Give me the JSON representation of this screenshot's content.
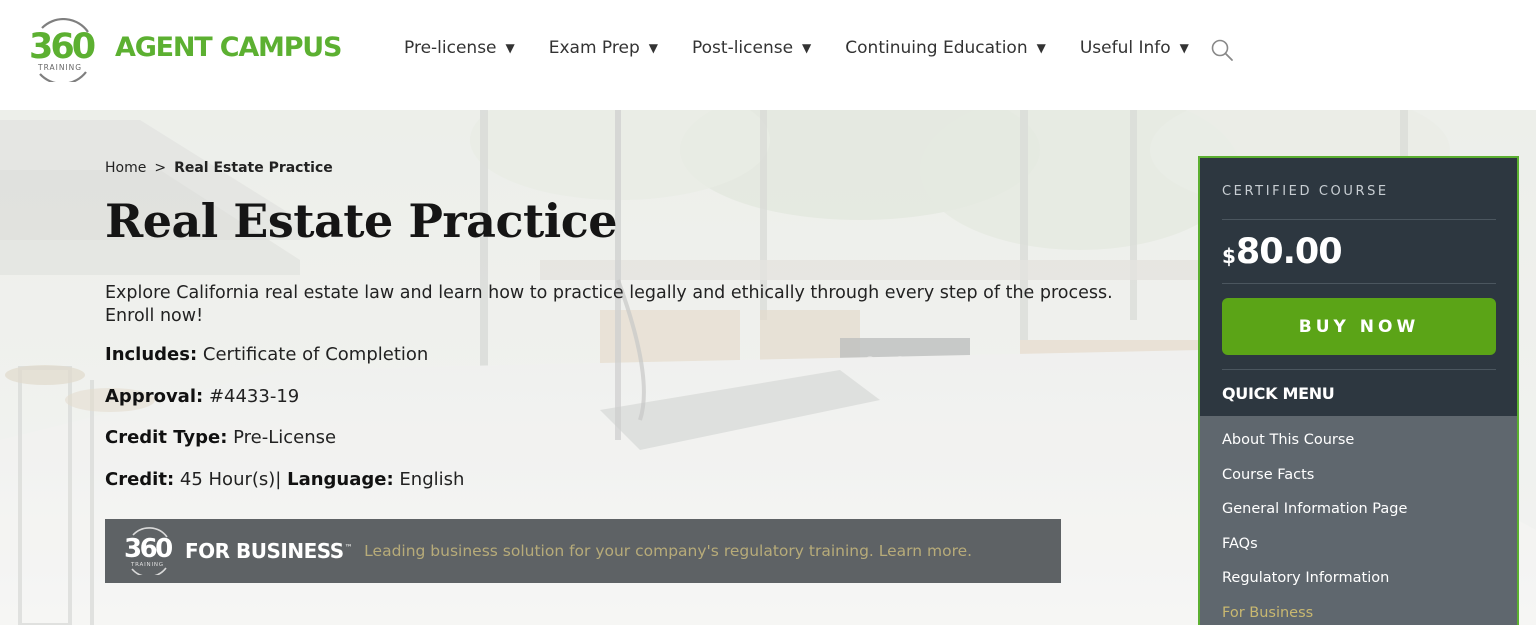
{
  "brand": {
    "logo_number": "360",
    "logo_sub": "TRAINING",
    "name": "AGENT CAMPUS",
    "color": "#5cb031"
  },
  "nav": {
    "items": [
      {
        "label": "Pre-license"
      },
      {
        "label": "Exam Prep"
      },
      {
        "label": "Post-license"
      },
      {
        "label": "Continuing Education"
      },
      {
        "label": "Useful Info"
      }
    ],
    "caret": "▼",
    "search_icon": "search-icon"
  },
  "breadcrumb": {
    "home": "Home",
    "separator": ">",
    "current": "Real Estate Practice"
  },
  "course": {
    "title": "Real Estate Practice",
    "description": "Explore California real estate law and learn how to practice legally and ethically through every step of the process. Enroll now!",
    "includes_label": "Includes:",
    "includes_value": "Certificate of Completion",
    "approval_label": "Approval:",
    "approval_value": "#4433-19",
    "credit_type_label": "Credit Type:",
    "credit_type_value": "Pre-License",
    "credit_label": "Credit:",
    "credit_value": "45 Hour(s)",
    "credit_sep": "|",
    "language_label": "Language:",
    "language_value": "English"
  },
  "business_banner": {
    "logo_number": "360",
    "logo_sub": "TRAINING",
    "title": "FOR BUSINESS",
    "tm": "™",
    "text": "Leading business solution for your company's regulatory training. Learn more."
  },
  "card": {
    "label": "CERTIFIED COURSE",
    "currency": "$",
    "price": "80.00",
    "buy_label": "BUY NOW",
    "quick_menu_title": "QUICK MENU",
    "quick_menu": [
      {
        "label": "About This Course"
      },
      {
        "label": "Course Facts"
      },
      {
        "label": "General Information Page"
      },
      {
        "label": "FAQs"
      },
      {
        "label": "Regulatory Information"
      },
      {
        "label": "For Business"
      }
    ],
    "accent": "#5ba417",
    "background": "#2d3740"
  }
}
